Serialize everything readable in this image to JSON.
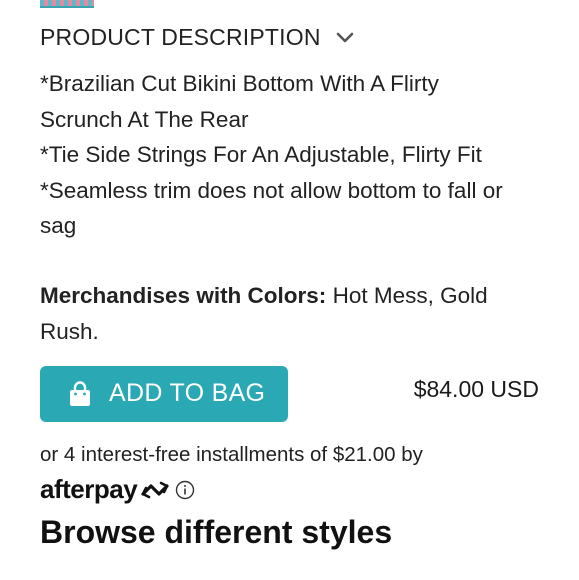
{
  "description": {
    "header_label": "PRODUCT DESCRIPTION",
    "lines": [
      "*Brazilian Cut Bikini Bottom With A Flirty",
      "Scrunch At The Rear",
      "*Tie Side Strings For An Adjustable, Flirty Fit",
      "*Seamless trim does not allow bottom to fall or",
      "sag"
    ]
  },
  "colors": {
    "label": "Merchandises with Colors:",
    "value_line1": " Hot Mess, Gold",
    "value_line2": "Rush."
  },
  "purchase": {
    "add_to_bag_label": "ADD TO BAG",
    "price": "$84.00 USD",
    "button_color": "#2aa9b4"
  },
  "afterpay": {
    "installments_text": "or 4 interest-free installments of $21.00 by",
    "logo_text": "afterpay",
    "icons": [
      "afterpay-arrows-icon",
      "info-icon"
    ]
  },
  "browse": {
    "heading": "Browse different styles"
  }
}
